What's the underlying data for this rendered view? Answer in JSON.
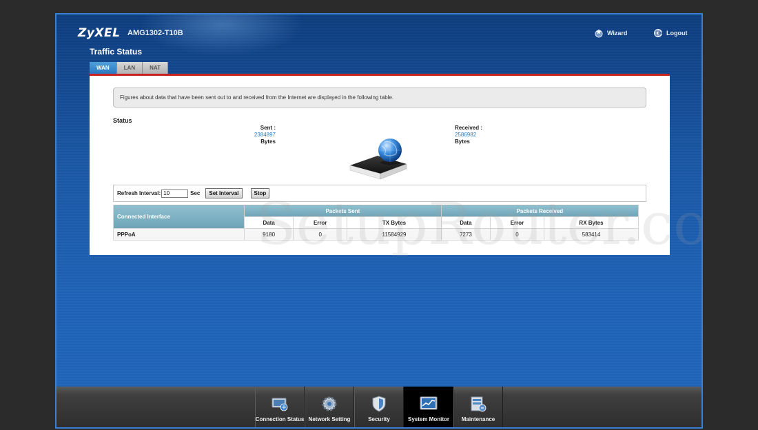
{
  "header": {
    "brand": "ZyXEL",
    "model": "AMG1302-T10B",
    "wizard_label": "Wizard",
    "logout_label": "Logout"
  },
  "page": {
    "title": "Traffic Status",
    "tabs": [
      {
        "label": "WAN",
        "active": true
      },
      {
        "label": "LAN",
        "active": false
      },
      {
        "label": "NAT",
        "active": false
      }
    ],
    "info_text": "Figures about data that have been sent out to and received from the Internet are displayed in the following table.",
    "status_heading": "Status"
  },
  "status": {
    "sent_label": "Sent :",
    "sent_value": "2384897",
    "sent_unit": "Bytes",
    "received_label": "Received :",
    "received_value": "2586982",
    "received_unit": "Bytes"
  },
  "refresh": {
    "label": "Refresh Interval:",
    "value": "10",
    "unit": "Sec",
    "set_button": "Set Interval",
    "stop_button": "Stop"
  },
  "table": {
    "connected_interface_header": "Connected Interface",
    "packets_sent_header": "Packets Sent",
    "packets_received_header": "Packets Received",
    "sub_headers": [
      "Data",
      "Error",
      "TX Bytes",
      "Data",
      "Error",
      "RX Bytes"
    ],
    "rows": [
      {
        "interface": "PPPoA",
        "cells": [
          "9180",
          "0",
          "11584929",
          "7273",
          "0",
          "583414"
        ]
      }
    ]
  },
  "watermark": "SetupRouter.com",
  "bottom_nav": [
    {
      "label": "Connection Status",
      "icon": "connection-status-icon",
      "active": false
    },
    {
      "label": "Network Setting",
      "icon": "network-setting-gear-icon",
      "active": false
    },
    {
      "label": "Security",
      "icon": "security-shield-icon",
      "active": false
    },
    {
      "label": "System Monitor",
      "icon": "system-monitor-icon",
      "active": true
    },
    {
      "label": "Maintenance",
      "icon": "maintenance-icon",
      "active": false
    }
  ],
  "colors": {
    "accent_red": "#c8211f",
    "active_tab": "#2b79c1",
    "value_blue": "#2a7bbf",
    "table_header": "#7aaec0"
  }
}
